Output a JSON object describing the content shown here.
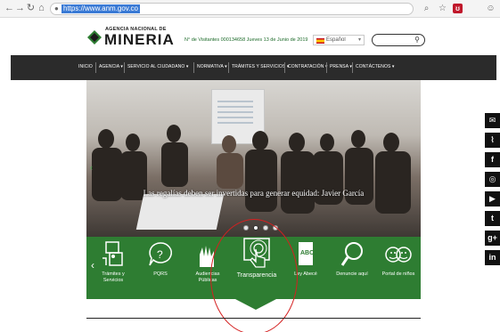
{
  "browser": {
    "url": "https://www.anm.gov.co",
    "nav_icons": [
      "back-icon",
      "forward-icon",
      "reload-icon",
      "home-icon"
    ],
    "toolbar_icons": [
      "zoom-icon",
      "star-icon",
      "extension-icon",
      "account-icon"
    ]
  },
  "site": {
    "logo_top": "AGENCIA NACIONAL DE",
    "logo_main": "MINERIA",
    "visits": "N° de Visitantes 000134658   Jueves 13 de Junio de 2019",
    "language": "Español",
    "search_placeholder": ""
  },
  "nav": [
    {
      "label": "INICIO"
    },
    {
      "label": "AGENCIA ▾"
    },
    {
      "label": "SERVICIO AL CIUDADANO ▾"
    },
    {
      "label": "NORMATIVA ▾"
    },
    {
      "label": "TRÁMITES Y SERVICIOS ▾"
    },
    {
      "label": "CONTRATACIÓN ▾"
    },
    {
      "label": "PRENSA ▾"
    },
    {
      "label": "CONTÁCTENOS ▾"
    }
  ],
  "hero": {
    "caption": "Las regalías deben ser invertidas para generar equidad: Javier García",
    "slide_count": 4,
    "active_slide": 2
  },
  "services": [
    {
      "label": "Trámites y Servicios",
      "icon": "documents-icon"
    },
    {
      "label": "PQRS",
      "icon": "question-bubble-icon"
    },
    {
      "label": "Audiencias Públicas",
      "icon": "hands-icon"
    },
    {
      "label": "Transparencia",
      "icon": "touch-screen-icon"
    },
    {
      "label": "Ley Abecé",
      "icon": "abc-book-icon"
    },
    {
      "label": "Denuncie aquí",
      "icon": "magnifier-icon"
    },
    {
      "label": "Portal de niños",
      "icon": "kids-icon"
    }
  ],
  "social": [
    {
      "icon": "email-icon",
      "glyph": "✉"
    },
    {
      "icon": "rss-icon",
      "glyph": "⌇"
    },
    {
      "icon": "facebook-icon",
      "glyph": "f"
    },
    {
      "icon": "instagram-icon",
      "glyph": "◎"
    },
    {
      "icon": "youtube-icon",
      "glyph": "▶"
    },
    {
      "icon": "twitter-icon",
      "glyph": "t"
    },
    {
      "icon": "google-plus-icon",
      "glyph": "g+"
    },
    {
      "icon": "linkedin-icon",
      "glyph": "in"
    }
  ],
  "colors": {
    "brand_green": "#2e7d32",
    "nav_dark": "#2b2b2b",
    "annotation_red": "#d42020"
  }
}
